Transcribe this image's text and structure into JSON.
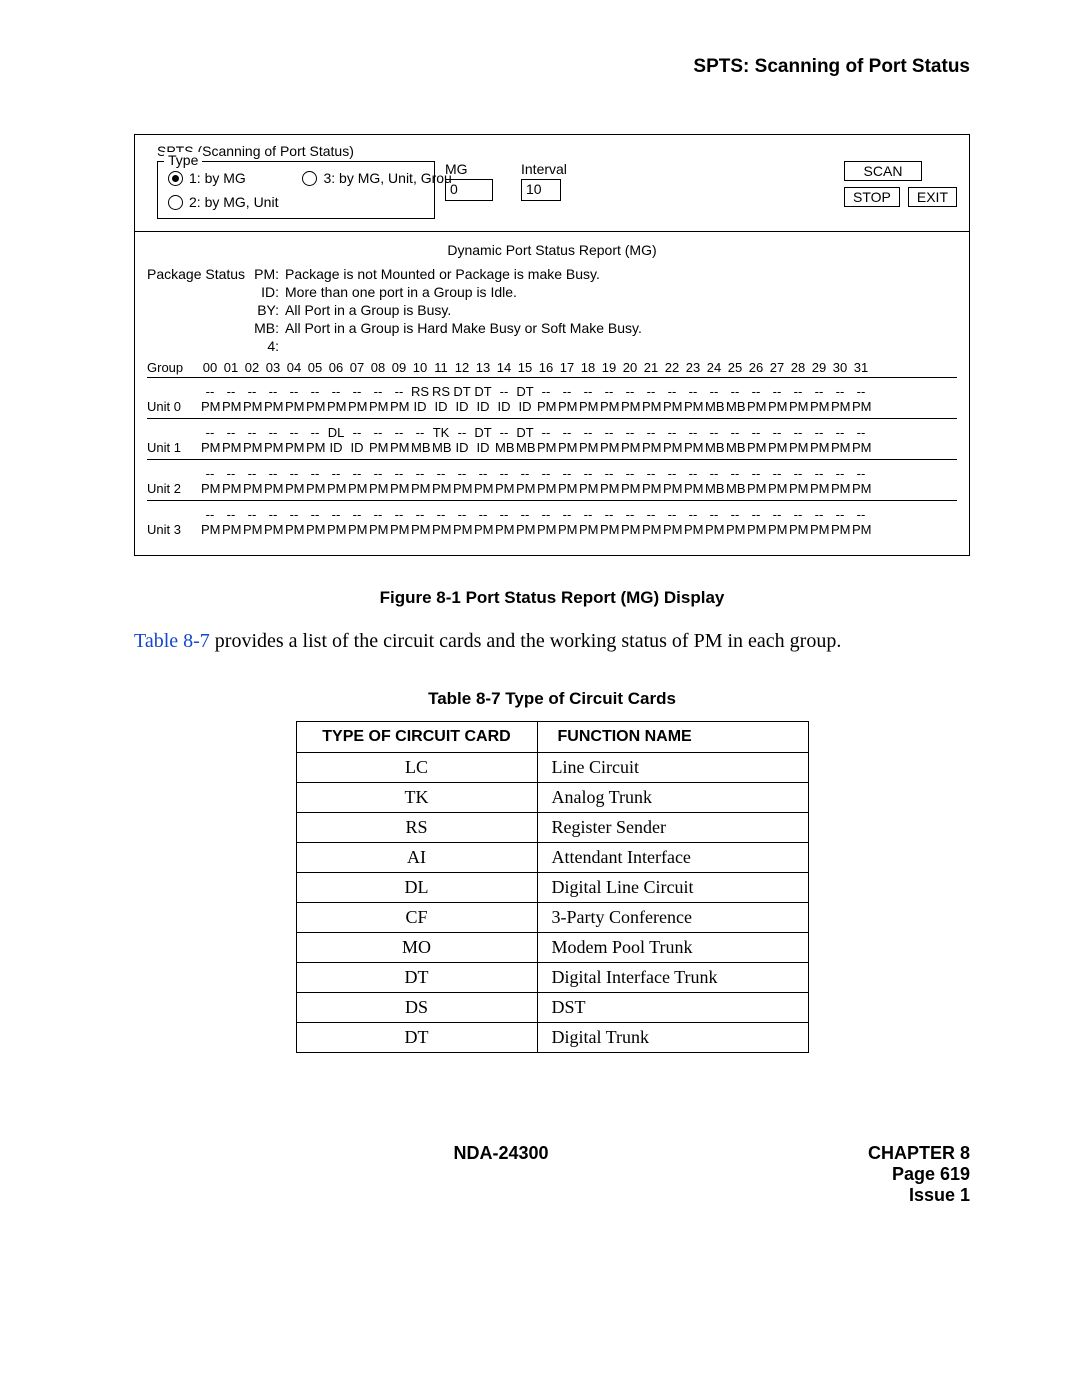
{
  "header": {
    "title": "SPTS:  Scanning of Port Status"
  },
  "screenshot": {
    "title": "SPTS (Scanning of Port Status)",
    "type_legend": "Type",
    "radios": {
      "r1": "1: by MG",
      "r2": "2: by MG, Unit",
      "r3": "3: by MG, Unit, Grou"
    },
    "mg_label": "MG",
    "mg_value": "0",
    "interval_label": "Interval",
    "interval_value": "10",
    "btn_scan": "SCAN",
    "btn_stop": "STOP",
    "btn_exit": "EXIT",
    "report_title": "Dynamic Port Status Report (MG)",
    "pkg_status_label": "Package Status",
    "legend_defs": [
      {
        "k": "PM:",
        "v": "Package is not Mounted or Package is make Busy."
      },
      {
        "k": "ID:",
        "v": "More than one port in a Group is Idle."
      },
      {
        "k": "BY:",
        "v": "All Port in a Group is Busy."
      },
      {
        "k": "MB:",
        "v": "All Port in a Group is Hard Make Busy or Soft Make Busy."
      },
      {
        "k": "4:",
        "v": ""
      }
    ],
    "group_label": "Group",
    "group_cols": [
      "00",
      "01",
      "02",
      "03",
      "04",
      "05",
      "06",
      "07",
      "08",
      "09",
      "10",
      "11",
      "12",
      "13",
      "14",
      "15",
      "16",
      "17",
      "18",
      "19",
      "20",
      "21",
      "22",
      "23",
      "24",
      "25",
      "26",
      "27",
      "28",
      "29",
      "30",
      "31"
    ],
    "units": [
      {
        "label": "Unit 0",
        "row_top": [
          "--",
          "--",
          "--",
          "--",
          "--",
          "--",
          "--",
          "--",
          "--",
          "--",
          "RS",
          "RS",
          "DT",
          "DT",
          "--",
          "DT",
          "--",
          "--",
          "--",
          "--",
          "--",
          "--",
          "--",
          "--",
          "--",
          "--",
          "--",
          "--",
          "--",
          "--",
          "--",
          "--"
        ],
        "row_bottom": [
          "PM",
          "PM",
          "PM",
          "PM",
          "PM",
          "PM",
          "PM",
          "PM",
          "PM",
          "PM",
          "ID",
          "ID",
          "ID",
          "ID",
          "ID",
          "ID",
          "PM",
          "PM",
          "PM",
          "PM",
          "PM",
          "PM",
          "PM",
          "PM",
          "MB",
          "MB",
          "PM",
          "PM",
          "PM",
          "PM",
          "PM",
          "PM"
        ]
      },
      {
        "label": "Unit 1",
        "row_top": [
          "--",
          "--",
          "--",
          "--",
          "--",
          "--",
          "DL",
          "--",
          "--",
          "--",
          "--",
          "TK",
          "--",
          "DT",
          "--",
          "DT",
          "--",
          "--",
          "--",
          "--",
          "--",
          "--",
          "--",
          "--",
          "--",
          "--",
          "--",
          "--",
          "--",
          "--",
          "--",
          "--"
        ],
        "row_bottom": [
          "PM",
          "PM",
          "PM",
          "PM",
          "PM",
          "PM",
          "ID",
          "ID",
          "PM",
          "PM",
          "MB",
          "MB",
          "ID",
          "ID",
          "MB",
          "MB",
          "PM",
          "PM",
          "PM",
          "PM",
          "PM",
          "PM",
          "PM",
          "PM",
          "MB",
          "MB",
          "PM",
          "PM",
          "PM",
          "PM",
          "PM",
          "PM"
        ]
      },
      {
        "label": "Unit 2",
        "row_top": [
          "--",
          "--",
          "--",
          "--",
          "--",
          "--",
          "--",
          "--",
          "--",
          "--",
          "--",
          "--",
          "--",
          "--",
          "--",
          "--",
          "--",
          "--",
          "--",
          "--",
          "--",
          "--",
          "--",
          "--",
          "--",
          "--",
          "--",
          "--",
          "--",
          "--",
          "--",
          "--"
        ],
        "row_bottom": [
          "PM",
          "PM",
          "PM",
          "PM",
          "PM",
          "PM",
          "PM",
          "PM",
          "PM",
          "PM",
          "PM",
          "PM",
          "PM",
          "PM",
          "PM",
          "PM",
          "PM",
          "PM",
          "PM",
          "PM",
          "PM",
          "PM",
          "PM",
          "PM",
          "MB",
          "MB",
          "PM",
          "PM",
          "PM",
          "PM",
          "PM",
          "PM"
        ]
      },
      {
        "label": "Unit 3",
        "row_top": [
          "--",
          "--",
          "--",
          "--",
          "--",
          "--",
          "--",
          "--",
          "--",
          "--",
          "--",
          "--",
          "--",
          "--",
          "--",
          "--",
          "--",
          "--",
          "--",
          "--",
          "--",
          "--",
          "--",
          "--",
          "--",
          "--",
          "--",
          "--",
          "--",
          "--",
          "--",
          "--"
        ],
        "row_bottom": [
          "PM",
          "PM",
          "PM",
          "PM",
          "PM",
          "PM",
          "PM",
          "PM",
          "PM",
          "PM",
          "PM",
          "PM",
          "PM",
          "PM",
          "PM",
          "PM",
          "PM",
          "PM",
          "PM",
          "PM",
          "PM",
          "PM",
          "PM",
          "PM",
          "PM",
          "PM",
          "PM",
          "PM",
          "PM",
          "PM",
          "PM",
          "PM"
        ]
      }
    ]
  },
  "figure_caption": "Figure 8-1   Port Status Report (MG) Display",
  "paragraph": {
    "link_text": "Table 8-7",
    "rest": " provides a list of the circuit cards and the working status of PM in each group."
  },
  "table_caption": "Table 8-7  Type of Circuit Cards",
  "table": {
    "h1": "TYPE OF CIRCUIT CARD",
    "h2": "FUNCTION NAME",
    "rows": [
      {
        "t": "LC",
        "f": "Line Circuit"
      },
      {
        "t": "TK",
        "f": "Analog Trunk"
      },
      {
        "t": "RS",
        "f": "Register Sender"
      },
      {
        "t": "AI",
        "f": "Attendant Interface"
      },
      {
        "t": "DL",
        "f": "Digital Line Circuit"
      },
      {
        "t": "CF",
        "f": "3-Party Conference"
      },
      {
        "t": "MO",
        "f": "Modem Pool Trunk"
      },
      {
        "t": "DT",
        "f": "Digital Interface Trunk"
      },
      {
        "t": "DS",
        "f": "DST"
      },
      {
        "t": "DT",
        "f": "Digital Trunk"
      }
    ]
  },
  "footer": {
    "doc": "NDA-24300",
    "chapter": "CHAPTER 8",
    "page": "Page 619",
    "issue": "Issue 1"
  }
}
